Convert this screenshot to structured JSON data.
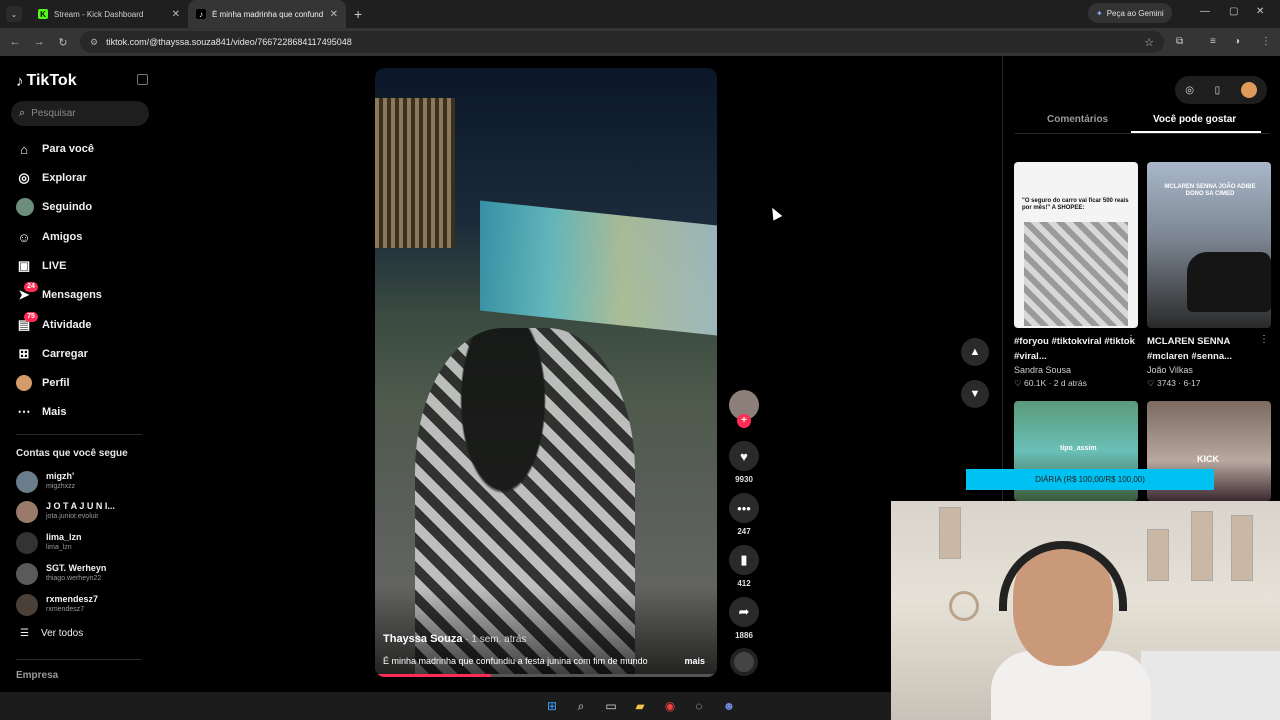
{
  "browser": {
    "tabs": [
      {
        "title": "Stream - Kick Dashboard",
        "icon": "kick-icon"
      },
      {
        "title": "É minha madrinha que confund",
        "icon": "tiktok-icon"
      }
    ],
    "gemini_label": "Peça ao Gemini",
    "url": "tiktok.com/@thayssa.souza841/video/7667228684117495048"
  },
  "tiktok": {
    "logo": "TikTok",
    "search_placeholder": "Pesquisar",
    "nav": [
      {
        "label": "Para você",
        "icon": "home-icon"
      },
      {
        "label": "Explorar",
        "icon": "compass-icon"
      },
      {
        "label": "Seguindo",
        "icon": "following-avatar"
      },
      {
        "label": "Amigos",
        "icon": "friends-icon"
      },
      {
        "label": "LIVE",
        "icon": "live-icon"
      },
      {
        "label": "Mensagens",
        "icon": "messages-icon",
        "badge": "24"
      },
      {
        "label": "Atividade",
        "icon": "activity-icon",
        "badge": "75"
      },
      {
        "label": "Carregar",
        "icon": "upload-icon"
      },
      {
        "label": "Perfil",
        "icon": "profile-avatar"
      },
      {
        "label": "Mais",
        "icon": "more-icon"
      }
    ],
    "following_title": "Contas que você segue",
    "following": [
      {
        "name": "migzh'",
        "handle": "migzhxzz"
      },
      {
        "name": "J O T A J U N I...",
        "handle": "jota.junior.evoluir"
      },
      {
        "name": "lima_lzn",
        "handle": "lima_lzn"
      },
      {
        "name": "SGT. Werheyn",
        "handle": "thiago.werheyn22"
      },
      {
        "name": "rxmendesz7",
        "handle": "rxmendesz7"
      }
    ],
    "see_all": "Ver todos",
    "company": "Empresa",
    "video": {
      "author": "Thayssa Souza",
      "time": " · 1 sem. atrás",
      "caption": "É minha madrinha que confundiu a festa junina com fim de mundo",
      "more": "mais",
      "progress": 0.34,
      "likes": "9930",
      "comments": "247",
      "saves": "412",
      "shares": "1886"
    },
    "panel": {
      "tabs": [
        "Comentários",
        "Você pode gostar"
      ],
      "active_tab": "Você pode gostar",
      "cards": [
        {
          "title": "#foryou #tiktokviral #tiktok #viral...",
          "author": "Sandra Sousa",
          "likes": "60.1K",
          "date": "2 d atrás",
          "thumb_text": "\"O seguro do carro vai ficar 500 reais por mês!\" A SHOPEE:"
        },
        {
          "title": "MCLAREN SENNA #mclaren #senna...",
          "author": "João Vilkas",
          "likes": "3743",
          "date": "6-17",
          "thumb_text": "MCLAREN SENNA JOÃO ADIBE DONO SA CIMED"
        },
        {
          "thumb_text": "tipo_assim"
        },
        {
          "thumb_text": "KICK"
        }
      ]
    }
  },
  "stream": {
    "donation_bar": "DIÁRIA (R$ 100,00/R$ 100,00)"
  },
  "colors": {
    "accent": "#fe2c55",
    "kick_green": "#53fc18",
    "donation": "#00c2f2"
  }
}
